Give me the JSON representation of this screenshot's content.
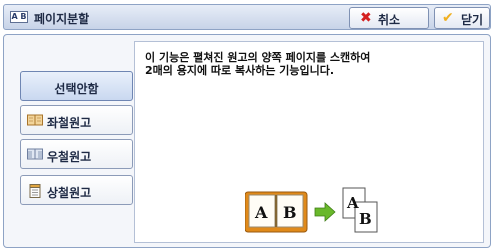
{
  "title_icon_text": "A B",
  "window_title": "페이지분할",
  "buttons": {
    "cancel": "취소",
    "close": "닫기"
  },
  "options": [
    {
      "label": "선택안함",
      "icon": "none",
      "selected": true
    },
    {
      "label": "좌철원고",
      "icon": "book-left-binding-icon",
      "selected": false
    },
    {
      "label": "우철원고",
      "icon": "book-right-binding-icon",
      "selected": false
    },
    {
      "label": "상철원고",
      "icon": "notepad-top-binding-icon",
      "selected": false
    }
  ],
  "description": "이 기능은 펼쳐진 원고의 양쪽 페이지를 스캔하여\n2매의 용지에 따로 복사하는 기능입니다.",
  "illustration": {
    "book_letters": [
      "A",
      "B"
    ],
    "result_letters": [
      "A",
      "B"
    ]
  },
  "colors": {
    "titlebar": "#c7d3e8",
    "cancel_icon": "#d42020",
    "close_icon": "#f0b020",
    "arrow": "#69b82b",
    "book_cover": "#e08a1a"
  }
}
